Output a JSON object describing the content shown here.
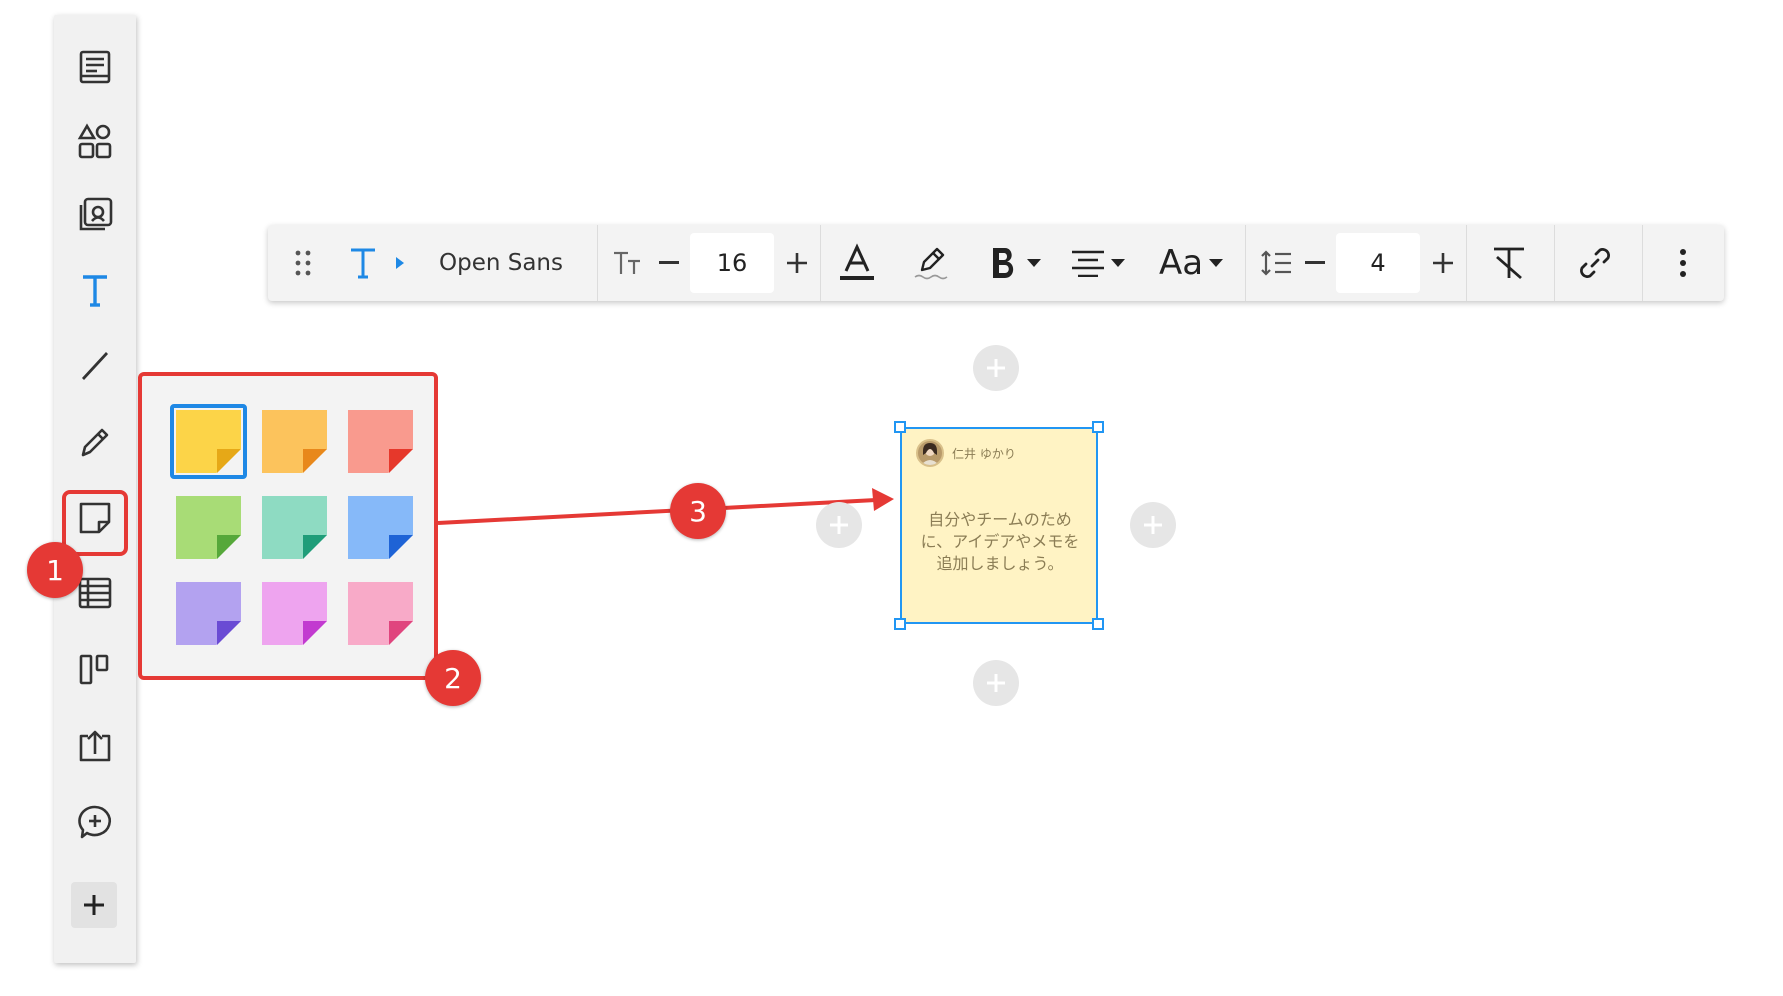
{
  "sidebar": {
    "tools": [
      {
        "name": "page-icon"
      },
      {
        "name": "shapes-icon"
      },
      {
        "name": "image-library-icon"
      },
      {
        "name": "text-icon"
      },
      {
        "name": "line-icon"
      },
      {
        "name": "pen-icon"
      },
      {
        "name": "sticky-note-icon"
      },
      {
        "name": "table-icon"
      },
      {
        "name": "kanban-icon"
      },
      {
        "name": "upload-icon"
      },
      {
        "name": "comment-add-icon"
      },
      {
        "name": "plus-icon"
      }
    ]
  },
  "format_bar": {
    "font_name": "Open Sans",
    "font_size": "16",
    "line_spacing": "4",
    "text_style_label": "Aa"
  },
  "palette": {
    "colors": [
      {
        "fill": "#fcd448",
        "fold": "#e6a817"
      },
      {
        "fill": "#fcc35c",
        "fold": "#e8881b"
      },
      {
        "fill": "#f99a8e",
        "fold": "#e6382b"
      },
      {
        "fill": "#a8dc76",
        "fold": "#56a83a"
      },
      {
        "fill": "#8edbc2",
        "fold": "#1f9d79"
      },
      {
        "fill": "#86b9f9",
        "fold": "#1e63d6"
      },
      {
        "fill": "#b3a2f0",
        "fold": "#6a4bd4"
      },
      {
        "fill": "#eea4ef",
        "fold": "#c23ad0"
      },
      {
        "fill": "#f8aac8",
        "fold": "#e0457e"
      }
    ],
    "selected_index": 0
  },
  "sticky_note": {
    "author": "仁井 ゆかり",
    "text": "自分やチームのため\nに、アイデアやメモを\n追加しましょう。",
    "background": "#fff3c4"
  },
  "badges": {
    "one": "1",
    "two": "2",
    "three": "3"
  },
  "colors": {
    "accent_red": "#e53935",
    "selection_blue": "#2196f3",
    "text_tool_blue": "#1e88e5"
  }
}
